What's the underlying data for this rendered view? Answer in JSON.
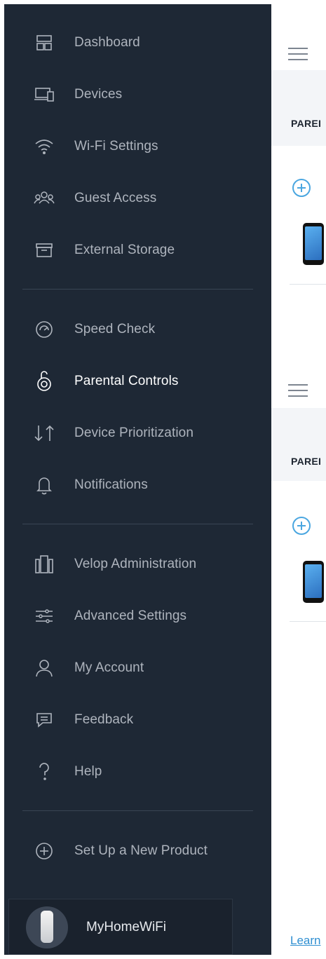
{
  "menu": {
    "items": [
      {
        "label": "Dashboard",
        "icon": "dashboard-icon"
      },
      {
        "label": "Devices",
        "icon": "devices-icon"
      },
      {
        "label": "Wi-Fi Settings",
        "icon": "wifi-icon"
      },
      {
        "label": "Guest Access",
        "icon": "guest-access-icon"
      },
      {
        "label": "External Storage",
        "icon": "storage-icon"
      },
      {
        "label": "Speed Check",
        "icon": "speedometer-icon"
      },
      {
        "label": "Parental Controls",
        "icon": "lock-icon",
        "active": true
      },
      {
        "label": "Device Prioritization",
        "icon": "up-down-arrows-icon"
      },
      {
        "label": "Notifications",
        "icon": "bell-icon"
      },
      {
        "label": "Velop Administration",
        "icon": "router-nodes-icon"
      },
      {
        "label": "Advanced Settings",
        "icon": "sliders-icon"
      },
      {
        "label": "My Account",
        "icon": "person-icon"
      },
      {
        "label": "Feedback",
        "icon": "speech-bubble-icon"
      },
      {
        "label": "Help",
        "icon": "question-icon"
      },
      {
        "label": "Set Up a New Product",
        "icon": "add-circle-icon"
      }
    ]
  },
  "footer": {
    "network_name": "MyHomeWiFi"
  },
  "background": {
    "section_label_1": "PAREI",
    "section_label_2": "PAREI",
    "learn_link": "Learn"
  },
  "colors": {
    "drawer_bg": "#1e2835",
    "text_inactive": "#aeb4bd",
    "text_active": "#ffffff",
    "accent": "#4aa6e0"
  }
}
